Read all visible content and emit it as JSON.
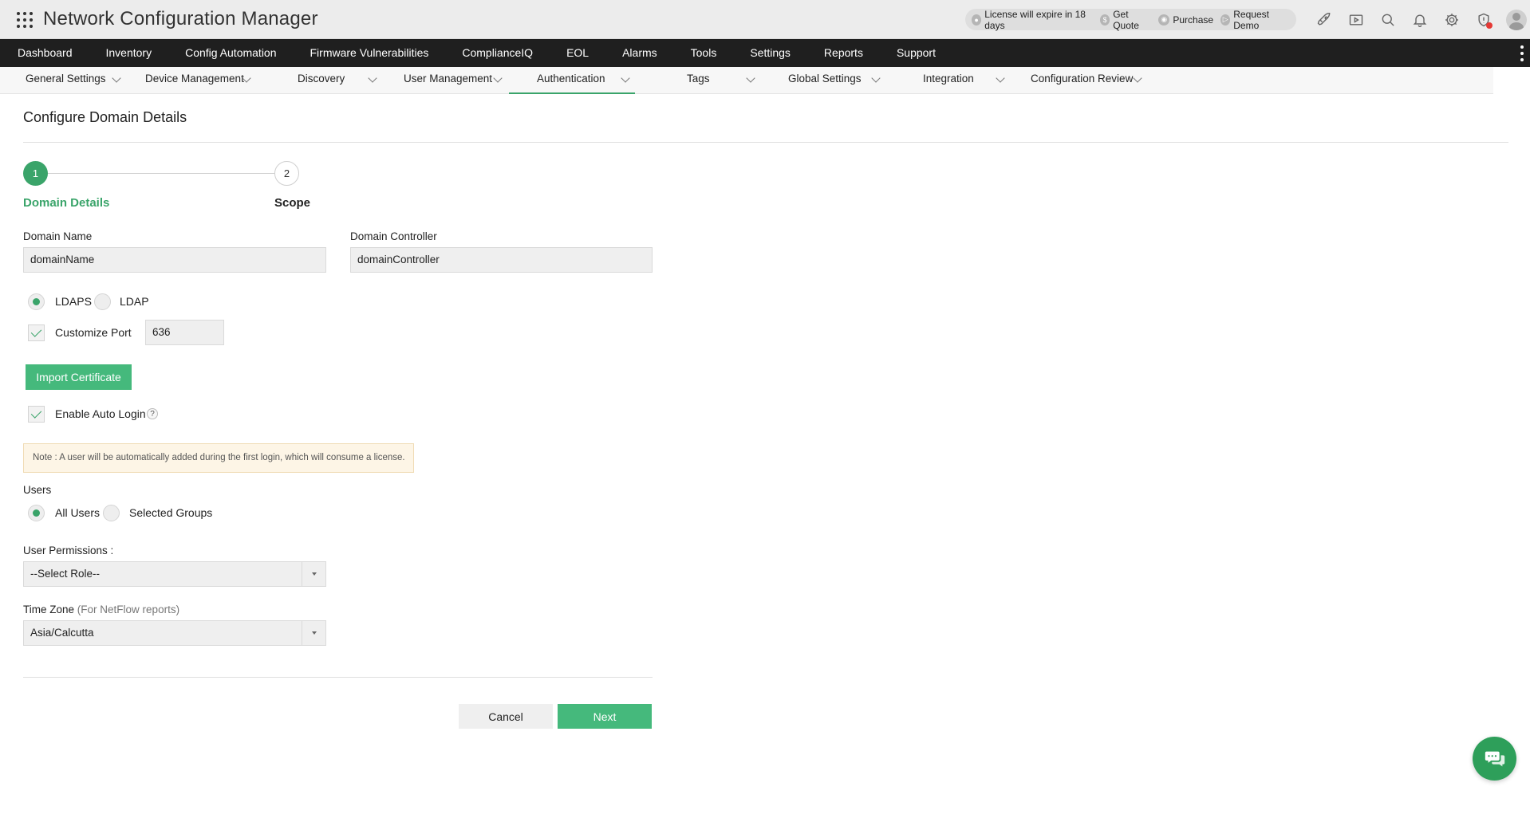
{
  "app": {
    "title": "Network Configuration Manager"
  },
  "license_bar": {
    "expiry": "License will expire in 18 days",
    "get_quote": "Get Quote",
    "purchase": "Purchase",
    "request_demo": "Request Demo"
  },
  "main_nav": [
    "Dashboard",
    "Inventory",
    "Config Automation",
    "Firmware Vulnerabilities",
    "ComplianceIQ",
    "EOL",
    "Alarms",
    "Tools",
    "Settings",
    "Reports",
    "Support"
  ],
  "sub_nav": [
    "General Settings",
    "Device Management",
    "Discovery",
    "User Management",
    "Authentication",
    "Tags",
    "Global Settings",
    "Integration",
    "Configuration Review"
  ],
  "page": {
    "title": "Configure Domain Details"
  },
  "stepper": {
    "step1_number": "1",
    "step1_label": "Domain Details",
    "step2_number": "2",
    "step2_label": "Scope"
  },
  "form": {
    "domain_name_label": "Domain Name",
    "domain_name_value": "domainName",
    "domain_controller_label": "Domain Controller",
    "domain_controller_value": "domainController",
    "protocol_ldaps": "LDAPS",
    "protocol_ldap": "LDAP",
    "customize_port_label": "Customize Port",
    "port_value": "636",
    "import_certificate": "Import Certificate",
    "enable_auto_login": "Enable Auto Login",
    "help": "?",
    "note": "Note : A user will be automatically added during the first login, which will consume a license.",
    "users_label": "Users",
    "all_users": "All Users",
    "selected_groups": "Selected Groups",
    "user_permissions_label": "User Permissions :",
    "role_value": "--Select Role--",
    "time_zone_label": "Time Zone",
    "time_zone_suffix": "(For NetFlow reports)",
    "time_zone_value": "Asia/Calcutta",
    "cancel": "Cancel",
    "next": "Next"
  },
  "colors": {
    "accent": "#3aa46a",
    "button_green": "#45b97c",
    "nav_bg": "#1f1f1f",
    "note_bg": "#fdf5e6"
  },
  "icons": [
    "apps-grid-icon",
    "rocket-icon",
    "video-icon",
    "search-icon",
    "bell-icon",
    "gear-icon",
    "alert-shield-icon",
    "user-avatar-icon",
    "chat-icon"
  ]
}
